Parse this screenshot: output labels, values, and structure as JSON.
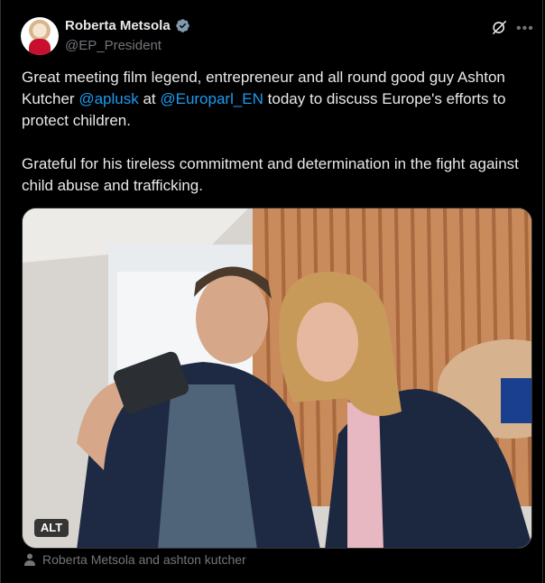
{
  "author": {
    "name": "Roberta Metsola",
    "handle": "@EP_President"
  },
  "tweet": {
    "line1_pre": "Great meeting film legend, entrepreneur and all round good guy Ashton Kutcher ",
    "mention1": "@aplusk",
    "line1_mid": " at ",
    "mention2": "@Europarl_EN",
    "line1_post": " today to discuss Europe's efforts to protect children.",
    "paragraph2": "Grateful for his tireless commitment and determination in the fight against child abuse and trafficking."
  },
  "media": {
    "alt_label": "ALT",
    "tagged": "Roberta Metsola and ashton kutcher"
  },
  "icons": {
    "verified": "verified-badge-icon",
    "grok": "grok-icon",
    "more": "more-icon",
    "person": "person-icon"
  },
  "colors": {
    "link": "#1d9bf0",
    "verified": "#829aab",
    "secondary": "#71767b"
  }
}
